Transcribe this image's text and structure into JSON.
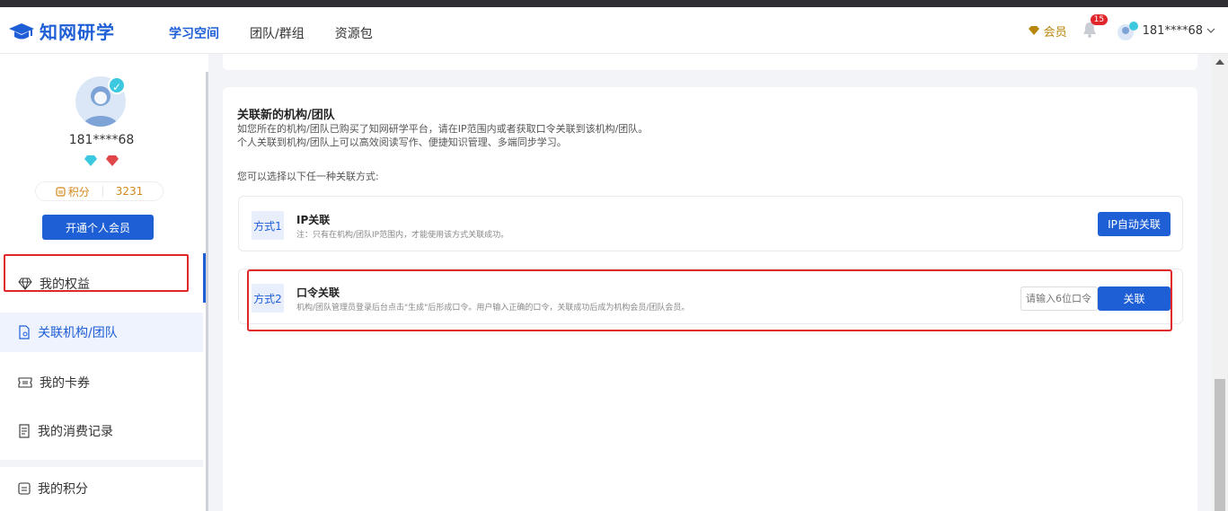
{
  "header": {
    "logo_text": "知网研学",
    "nav": [
      {
        "label": "学习空间",
        "active": true
      },
      {
        "label": "团队/群组",
        "active": false
      },
      {
        "label": "资源包",
        "active": false
      }
    ],
    "member_label": "会员",
    "notification_count": "15",
    "username": "181****68"
  },
  "profile": {
    "username": "181****68",
    "points_label": "积分",
    "points_value": "3231",
    "open_vip_label": "开通个人会员"
  },
  "sidebar": {
    "items": [
      {
        "label": "我的权益",
        "icon": "diamond-icon"
      },
      {
        "label": "关联机构/团队",
        "icon": "org-link-icon",
        "active": true
      },
      {
        "label": "我的卡券",
        "icon": "ticket-icon"
      },
      {
        "label": "我的消费记录",
        "icon": "receipt-icon"
      },
      {
        "label": "我的积分",
        "icon": "points-icon"
      }
    ]
  },
  "panel": {
    "title": "关联新的机构/团队",
    "desc_line1": "如您所在的机构/团队已购买了知网研学平台，请在IP范围内或者获取口令关联到该机构/团队。",
    "desc_line2": "个人关联到机构/团队上可以高效阅读写作、便捷知识管理、多端同步学习。",
    "choose_text": "您可以选择以下任一种关联方式:",
    "methods": [
      {
        "tag": "方式1",
        "name": "IP关联",
        "note": "注：只有在机构/团队IP范围内，才能使用该方式关联成功。",
        "button": "IP自动关联"
      },
      {
        "tag": "方式2",
        "name": "口令关联",
        "note": "机构/团队管理员登录后台点击\"生成\"后形成口令。用户输入正确的口令，关联成功后成为机构会员/团队会员。",
        "input_placeholder": "请输入6位口令",
        "button": "关联"
      }
    ]
  },
  "colors": {
    "brand": "#1f5fd6",
    "highlight": "#e02828",
    "points": "#d2881c"
  }
}
